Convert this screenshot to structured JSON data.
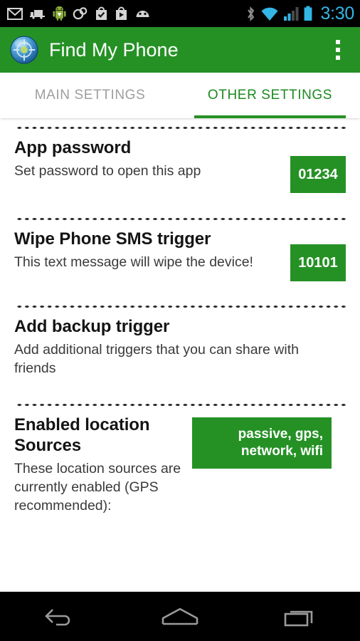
{
  "status_bar": {
    "time": "3:30",
    "left_icons": [
      "gmail-icon",
      "shipment-truck-icon",
      "android-robot-icon",
      "link-circles-icon",
      "checkmark-bag-icon",
      "play-store-bag-icon",
      "android-face-icon"
    ],
    "right_icons": [
      "bluetooth-icon",
      "wifi-icon",
      "cellular-signal-icon",
      "battery-icon"
    ],
    "colors": {
      "background": "#000000",
      "accent": "#33b5e5",
      "inactive": "#8c8c8c"
    }
  },
  "action_bar": {
    "app_icon": "globe-target-icon",
    "title": "Find My Phone",
    "overflow_label": "overflow-menu",
    "color": "#259125"
  },
  "tabs": [
    {
      "label": "MAIN SETTINGS",
      "active": false
    },
    {
      "label": "OTHER SETTINGS",
      "active": true
    }
  ],
  "settings": [
    {
      "title": "App password",
      "subtitle": "Set password to open this app",
      "badge": "01234",
      "badge_size": "small"
    },
    {
      "title": "Wipe Phone SMS trigger",
      "subtitle": "This text message will wipe the device!",
      "badge": "10101",
      "badge_size": "small"
    },
    {
      "title": "Add backup trigger",
      "subtitle": "Add additional triggers that you can share with friends",
      "badge": null,
      "badge_size": null
    },
    {
      "title": "Enabled location Sources",
      "subtitle": "These location sources are currently enabled (GPS recommended):",
      "badge": "passive, gps, network, wifi",
      "badge_size": "wide"
    }
  ],
  "nav_bar": {
    "back_label": "back-button",
    "home_label": "home-button",
    "recents_label": "recents-button"
  },
  "colors": {
    "brand_green": "#259125",
    "tab_active": "#1d8a20",
    "tab_inactive": "#9e9e9e",
    "title_text": "#141414",
    "subtitle_text": "#3a3a3a"
  }
}
